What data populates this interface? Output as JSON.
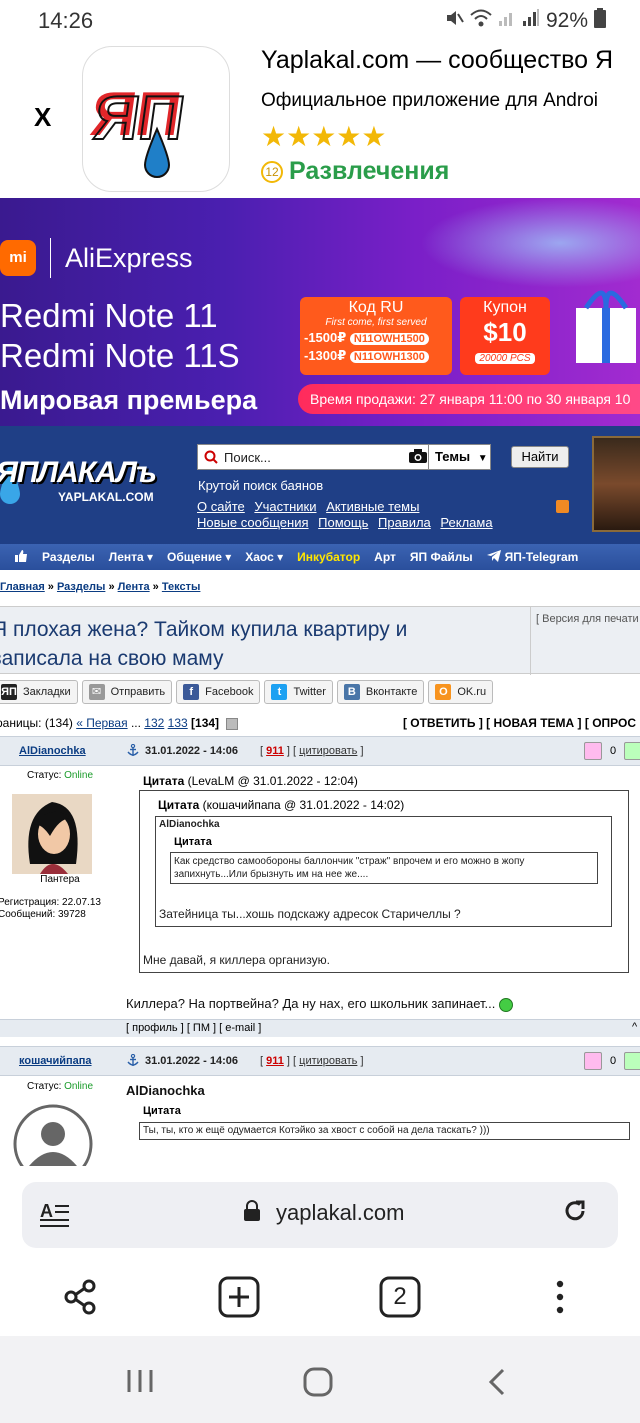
{
  "status": {
    "time": "14:26",
    "battery": "92%"
  },
  "app_banner": {
    "close": "X",
    "title": "Yaplakal.com — сообщество Я",
    "subtitle": "Официальное приложение для Androi",
    "stars": "★★★★★",
    "age": "12",
    "category": "Развлечения"
  },
  "ad": {
    "brand_mi": "mi",
    "brand": "AliExpress",
    "headline1": "Redmi Note 11",
    "headline2": "Redmi Note 11S",
    "premiere": "Мировая премьера",
    "code_title": "Код RU",
    "code_sub": "First come, first served",
    "code_line1_amount": "-1500₽",
    "code_line1_code": "N11OWH1500",
    "code_line2_amount": "-1300₽",
    "code_line2_code": "N11OWH1300",
    "coupon_title": "Купон",
    "coupon_value": "$10",
    "coupon_pcs": "20000 PCS",
    "sale_time": "Время продажи: 27 января 11:00 по 30 января 10"
  },
  "site_header": {
    "logo": "ЯПЛАКАЛъ",
    "logo_sub": "YAPLAKAL.COM",
    "search_placeholder": "Поиск...",
    "search_select": "Темы",
    "find_button": "Найти",
    "search_hint": "Крутой поиск баянов",
    "links_row1": [
      "О сайте",
      "Участники",
      "Активные темы"
    ],
    "links_row2": [
      "Новые сообщения",
      "Помощь",
      "Правила",
      "Реклама"
    ]
  },
  "nav": {
    "items": [
      "Разделы",
      "Лента ▾",
      "Общение ▾",
      "Хаос ▾",
      "Инкубатор",
      "Арт",
      "ЯП Файлы",
      "ЯП-Telegram"
    ]
  },
  "breadcrumb": {
    "items": [
      "Главная",
      "Разделы",
      "Лента",
      "Тексты"
    ],
    "sep": " » "
  },
  "topic": {
    "title": "Я плохая жена? Тайком купила квартиру и записала на свою маму",
    "print_version": "[ Версия для печати ]"
  },
  "share": {
    "buttons": [
      {
        "icon": "bookmark-icon",
        "label": "Закладки",
        "color": "#333333"
      },
      {
        "icon": "mail-icon",
        "label": "Отправить",
        "color": "#888888"
      },
      {
        "icon": "facebook-icon",
        "label": "Facebook",
        "color": "#3b5998"
      },
      {
        "icon": "twitter-icon",
        "label": "Twitter",
        "color": "#1da1f2"
      },
      {
        "icon": "vk-icon",
        "label": "Вконтакте",
        "color": "#4a76a8"
      },
      {
        "icon": "ok-icon",
        "label": "OK.ru",
        "color": "#f7931e"
      }
    ]
  },
  "pager": {
    "left_prefix": "раницы: (134) ",
    "first": "« Первая",
    "dots": " ... ",
    "p132": "132",
    "p133": "133",
    "p134": "[134]",
    "right": "[ ОТВЕТИТЬ ] [ НОВАЯ ТЕМА ] [ ОПРОС"
  },
  "post1": {
    "nick": "AlDianochka",
    "date": "31.01.2022 - 14:06",
    "num": "911",
    "quote_link": "цитировать",
    "rating": "0",
    "status_label": "Статус: ",
    "status": "Online",
    "rank": "Пантера",
    "reg": "Регистрация: 22.07.13",
    "msgs": "Сообщений: 39728",
    "q1_title": "Цитата",
    "q1_meta": " (LevaLM @ 31.01.2022 - 12:04)",
    "q2_title": "Цитата",
    "q2_meta": " (кошачийпапа @ 31.01.2022 - 14:02)",
    "q3_author": "AlDianochka",
    "q3_title": "Цитата",
    "q3_text": "Как средство самообороны баллончик \"страж\" впрочем и его можно в жопу запихнуть...Или брызнуть им на нее же....",
    "q2_text": "Затейница ты...хошь подскажу адресок Старичеллы ?",
    "q1_text": "Мне давай, я киллера организую.",
    "text": "Киллера? На портвейна? Да ну нах, его школьник запинает...",
    "footer": "[ профиль ] [ ПМ ] [ e-mail ]"
  },
  "post2": {
    "nick": "кошачийпапа",
    "date": "31.01.2022 - 14:06",
    "num": "911",
    "quote_link": "цитировать",
    "rating": "0",
    "status_label": "Статус: ",
    "status": "Online",
    "author": "AlDianochka",
    "q_title": "Цитата",
    "q_text": "Ты, ты, кто ж ещё одумается Котэйко за хвост с собой на дела таскать? )))"
  },
  "browser": {
    "url": "yaplakal.com",
    "tabs": "2"
  }
}
